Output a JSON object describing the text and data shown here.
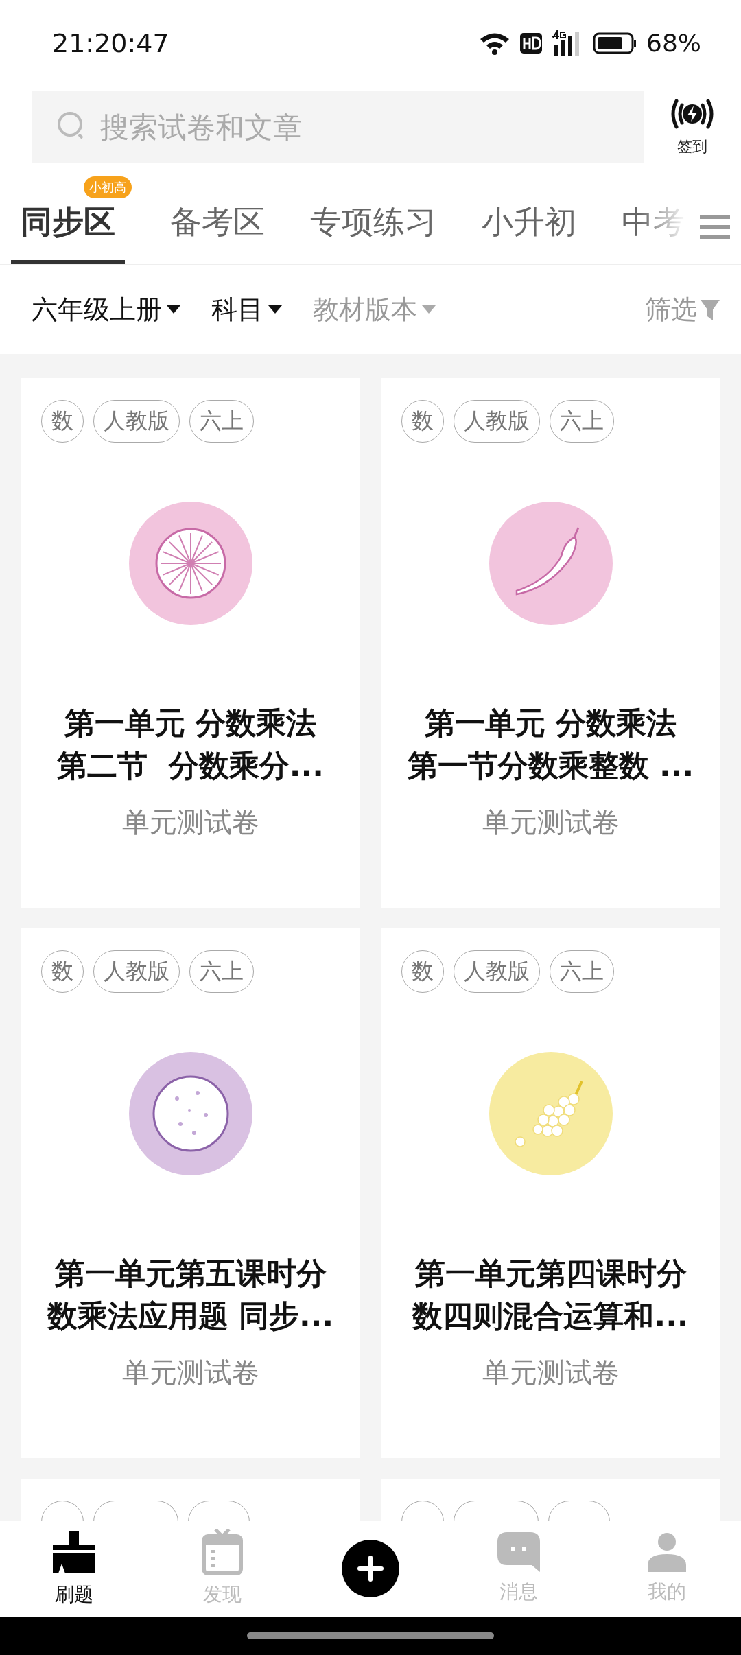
{
  "status_bar": {
    "time": "21:20:47",
    "battery": "68%"
  },
  "search": {
    "placeholder": "搜索试卷和文章"
  },
  "checkin": {
    "label": "签到"
  },
  "tabs": [
    {
      "label": "同步区",
      "selected": true,
      "badge": "小初高"
    },
    {
      "label": "备考区",
      "selected": false
    },
    {
      "label": "专项练习",
      "selected": false
    },
    {
      "label": "小升初",
      "selected": false
    },
    {
      "label": "中考",
      "selected": false
    }
  ],
  "filters": [
    {
      "label": "六年级上册",
      "enabled": true
    },
    {
      "label": "科目",
      "enabled": true
    },
    {
      "label": "教材版本",
      "enabled": false
    }
  ],
  "filter_button": {
    "label": "筛选"
  },
  "cards": [
    {
      "tags": [
        "数",
        "人教版",
        "六上"
      ],
      "kind": "citrus",
      "color": "#f2c4dd",
      "title_lines": [
        "第一单元 分数乘法",
        "第二节  分数乘分..."
      ],
      "type": "单元测试卷"
    },
    {
      "tags": [
        "数",
        "人教版",
        "六上"
      ],
      "kind": "chili",
      "color": "#f2c4dd",
      "title_lines": [
        "第一单元 分数乘法",
        "第一节分数乘整数 ..."
      ],
      "type": "单元测试卷"
    },
    {
      "tags": [
        "数",
        "人教版",
        "六上"
      ],
      "kind": "plate",
      "color": "#d9c1e2",
      "title_lines": [
        "第一单元第五课时分",
        "数乘法应用题 同步..."
      ],
      "type": "单元测试卷"
    },
    {
      "tags": [
        "数",
        "人教版",
        "六上"
      ],
      "kind": "grapes",
      "color": "#f7eba0",
      "title_lines": [
        "第一单元第四课时分",
        "数四则混合运算和..."
      ],
      "type": "单元测试卷"
    }
  ],
  "more_cards": [
    {
      "kind": "partial"
    },
    {
      "kind": "partial"
    }
  ],
  "bottom_nav": [
    {
      "kind": "brush",
      "label": "刷题",
      "selected": true
    },
    {
      "kind": "calendar",
      "label": "发现",
      "selected": false
    },
    {
      "kind": "plus"
    },
    {
      "kind": "chat",
      "label": "消息",
      "selected": false
    },
    {
      "kind": "person",
      "label": "我的",
      "selected": false
    }
  ]
}
